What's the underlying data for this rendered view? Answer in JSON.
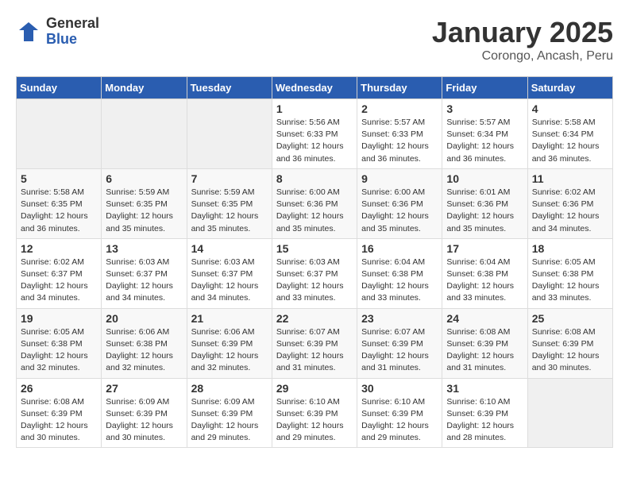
{
  "header": {
    "logo_general": "General",
    "logo_blue": "Blue",
    "title": "January 2025",
    "location": "Corongo, Ancash, Peru"
  },
  "days_of_week": [
    "Sunday",
    "Monday",
    "Tuesday",
    "Wednesday",
    "Thursday",
    "Friday",
    "Saturday"
  ],
  "weeks": [
    [
      {
        "day": "",
        "info": ""
      },
      {
        "day": "",
        "info": ""
      },
      {
        "day": "",
        "info": ""
      },
      {
        "day": "1",
        "info": "Sunrise: 5:56 AM\nSunset: 6:33 PM\nDaylight: 12 hours\nand 36 minutes."
      },
      {
        "day": "2",
        "info": "Sunrise: 5:57 AM\nSunset: 6:33 PM\nDaylight: 12 hours\nand 36 minutes."
      },
      {
        "day": "3",
        "info": "Sunrise: 5:57 AM\nSunset: 6:34 PM\nDaylight: 12 hours\nand 36 minutes."
      },
      {
        "day": "4",
        "info": "Sunrise: 5:58 AM\nSunset: 6:34 PM\nDaylight: 12 hours\nand 36 minutes."
      }
    ],
    [
      {
        "day": "5",
        "info": "Sunrise: 5:58 AM\nSunset: 6:35 PM\nDaylight: 12 hours\nand 36 minutes."
      },
      {
        "day": "6",
        "info": "Sunrise: 5:59 AM\nSunset: 6:35 PM\nDaylight: 12 hours\nand 35 minutes."
      },
      {
        "day": "7",
        "info": "Sunrise: 5:59 AM\nSunset: 6:35 PM\nDaylight: 12 hours\nand 35 minutes."
      },
      {
        "day": "8",
        "info": "Sunrise: 6:00 AM\nSunset: 6:36 PM\nDaylight: 12 hours\nand 35 minutes."
      },
      {
        "day": "9",
        "info": "Sunrise: 6:00 AM\nSunset: 6:36 PM\nDaylight: 12 hours\nand 35 minutes."
      },
      {
        "day": "10",
        "info": "Sunrise: 6:01 AM\nSunset: 6:36 PM\nDaylight: 12 hours\nand 35 minutes."
      },
      {
        "day": "11",
        "info": "Sunrise: 6:02 AM\nSunset: 6:36 PM\nDaylight: 12 hours\nand 34 minutes."
      }
    ],
    [
      {
        "day": "12",
        "info": "Sunrise: 6:02 AM\nSunset: 6:37 PM\nDaylight: 12 hours\nand 34 minutes."
      },
      {
        "day": "13",
        "info": "Sunrise: 6:03 AM\nSunset: 6:37 PM\nDaylight: 12 hours\nand 34 minutes."
      },
      {
        "day": "14",
        "info": "Sunrise: 6:03 AM\nSunset: 6:37 PM\nDaylight: 12 hours\nand 34 minutes."
      },
      {
        "day": "15",
        "info": "Sunrise: 6:03 AM\nSunset: 6:37 PM\nDaylight: 12 hours\nand 33 minutes."
      },
      {
        "day": "16",
        "info": "Sunrise: 6:04 AM\nSunset: 6:38 PM\nDaylight: 12 hours\nand 33 minutes."
      },
      {
        "day": "17",
        "info": "Sunrise: 6:04 AM\nSunset: 6:38 PM\nDaylight: 12 hours\nand 33 minutes."
      },
      {
        "day": "18",
        "info": "Sunrise: 6:05 AM\nSunset: 6:38 PM\nDaylight: 12 hours\nand 33 minutes."
      }
    ],
    [
      {
        "day": "19",
        "info": "Sunrise: 6:05 AM\nSunset: 6:38 PM\nDaylight: 12 hours\nand 32 minutes."
      },
      {
        "day": "20",
        "info": "Sunrise: 6:06 AM\nSunset: 6:38 PM\nDaylight: 12 hours\nand 32 minutes."
      },
      {
        "day": "21",
        "info": "Sunrise: 6:06 AM\nSunset: 6:39 PM\nDaylight: 12 hours\nand 32 minutes."
      },
      {
        "day": "22",
        "info": "Sunrise: 6:07 AM\nSunset: 6:39 PM\nDaylight: 12 hours\nand 31 minutes."
      },
      {
        "day": "23",
        "info": "Sunrise: 6:07 AM\nSunset: 6:39 PM\nDaylight: 12 hours\nand 31 minutes."
      },
      {
        "day": "24",
        "info": "Sunrise: 6:08 AM\nSunset: 6:39 PM\nDaylight: 12 hours\nand 31 minutes."
      },
      {
        "day": "25",
        "info": "Sunrise: 6:08 AM\nSunset: 6:39 PM\nDaylight: 12 hours\nand 30 minutes."
      }
    ],
    [
      {
        "day": "26",
        "info": "Sunrise: 6:08 AM\nSunset: 6:39 PM\nDaylight: 12 hours\nand 30 minutes."
      },
      {
        "day": "27",
        "info": "Sunrise: 6:09 AM\nSunset: 6:39 PM\nDaylight: 12 hours\nand 30 minutes."
      },
      {
        "day": "28",
        "info": "Sunrise: 6:09 AM\nSunset: 6:39 PM\nDaylight: 12 hours\nand 29 minutes."
      },
      {
        "day": "29",
        "info": "Sunrise: 6:10 AM\nSunset: 6:39 PM\nDaylight: 12 hours\nand 29 minutes."
      },
      {
        "day": "30",
        "info": "Sunrise: 6:10 AM\nSunset: 6:39 PM\nDaylight: 12 hours\nand 29 minutes."
      },
      {
        "day": "31",
        "info": "Sunrise: 6:10 AM\nSunset: 6:39 PM\nDaylight: 12 hours\nand 28 minutes."
      },
      {
        "day": "",
        "info": ""
      }
    ]
  ]
}
